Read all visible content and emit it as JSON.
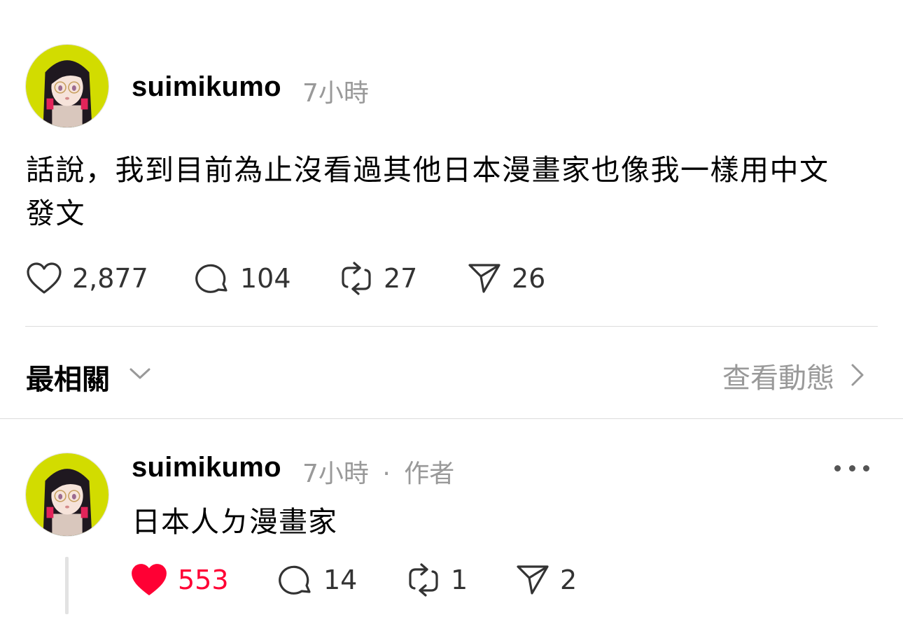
{
  "post": {
    "username": "suimikumo",
    "time": "7小時",
    "text_line1": "話說，我到目前為止沒看過其他日本漫畫家也像我一樣用中文",
    "text_line2": "發文",
    "actions": {
      "likes": "2,877",
      "comments": "104",
      "reposts": "27",
      "shares": "26"
    },
    "avatar_icon": "avatar-icon"
  },
  "sort_bar": {
    "sort_label": "最相關",
    "view_activity_label": "查看動態"
  },
  "reply": {
    "username": "suimikumo",
    "time": "7小時",
    "separator": "·",
    "author_badge": "作者",
    "text": "日本人ㄉ漫畫家",
    "actions": {
      "likes": "553",
      "comments": "14",
      "reposts": "1",
      "shares": "2"
    },
    "liked": true
  },
  "colors": {
    "avatar_bg": "#d2dc00",
    "like_active": "#ff0034",
    "meta_gray": "#999999",
    "divider": "#dcdcdc"
  }
}
